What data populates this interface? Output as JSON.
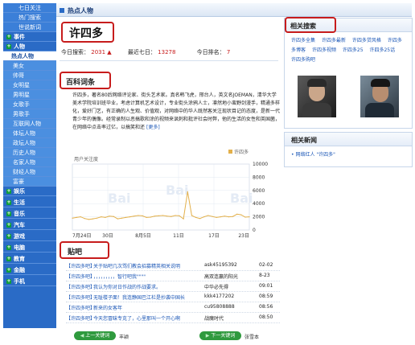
{
  "sidebar": {
    "items": [
      {
        "label": "七日关注",
        "kind": "top"
      },
      {
        "label": "热门搜索",
        "kind": "top"
      },
      {
        "label": "世说新词",
        "kind": "top"
      },
      {
        "label": "事件",
        "kind": "cat"
      },
      {
        "label": "人物",
        "kind": "cat"
      },
      {
        "label": "热点人物",
        "kind": "active"
      },
      {
        "label": "美女",
        "kind": "sub"
      },
      {
        "label": "帅哥",
        "kind": "sub"
      },
      {
        "label": "女明星",
        "kind": "sub"
      },
      {
        "label": "男明星",
        "kind": "sub"
      },
      {
        "label": "女歌手",
        "kind": "sub"
      },
      {
        "label": "男歌手",
        "kind": "sub"
      },
      {
        "label": "互联网人物",
        "kind": "sub"
      },
      {
        "label": "体坛人物",
        "kind": "sub"
      },
      {
        "label": "政坛人物",
        "kind": "sub"
      },
      {
        "label": "历史人物",
        "kind": "sub"
      },
      {
        "label": "名家人物",
        "kind": "sub"
      },
      {
        "label": "财经人物",
        "kind": "sub"
      },
      {
        "label": "富豪",
        "kind": "sub"
      },
      {
        "label": "娱乐",
        "kind": "cat"
      },
      {
        "label": "生活",
        "kind": "cat"
      },
      {
        "label": "音乐",
        "kind": "cat"
      },
      {
        "label": "汽车",
        "kind": "cat"
      },
      {
        "label": "游戏",
        "kind": "cat"
      },
      {
        "label": "电脑",
        "kind": "cat"
      },
      {
        "label": "教育",
        "kind": "cat"
      },
      {
        "label": "金融",
        "kind": "cat"
      },
      {
        "label": "手机",
        "kind": "cat"
      }
    ]
  },
  "header": {
    "title": "热点人物"
  },
  "person": {
    "name": "许四多",
    "today_search_label": "今日搜索：",
    "today_search_value": "2031",
    "recent7_label": "最近七日：",
    "recent7_value": "13278",
    "today_rank_label": "今日排名：",
    "today_rank_value": "7"
  },
  "baike": {
    "title": "百科词条",
    "text": "许四多，著名80后网络评论家、街头艺术家。真名韩飞虎，邢台人，英文名JOEMAN，清华大学美术学院培训班毕业，考虑计算机艺术设计，专业街头涂鸦人士，凛然地小蛮野剑漫手，精通多样化，爱好门艺，有正确的人生观、价值观，对网络中的华人既然客关注现状目记的态度，是新一代青少年的偶像。经常录制以恶搞歌和涂的视频来讽刺和批评社会时弊，他的生活的女性和英国菌，在网络中点击率过亿，以搞笑和还",
    "more": "[更多]"
  },
  "chart_data": {
    "type": "line",
    "title": "",
    "ylabel": "用户关注度",
    "legend": "许四多",
    "xtick_labels": [
      "7月24日",
      "30日",
      "8月5日",
      "11日",
      "17日",
      "23日"
    ],
    "ytick_labels": [
      "10000",
      "8000",
      "6000",
      "4000",
      "2000",
      "0"
    ],
    "ylim": [
      0,
      10000
    ],
    "values": [
      1800,
      1900,
      2000,
      1750,
      1600,
      1700,
      1800,
      2000,
      1900,
      2100,
      2050,
      1700,
      1800,
      1900,
      2000,
      2100,
      2200,
      2150,
      1900,
      1950,
      2100,
      2150,
      2200,
      2100,
      2050,
      2200,
      2150,
      1700,
      5800,
      2200,
      1900,
      1750,
      2000,
      2200,
      2050,
      1900,
      2000,
      2100,
      2000,
      2050,
      2400,
      2300,
      1950,
      2000
    ]
  },
  "tieba": {
    "title": "贴吧",
    "rows": [
      {
        "tag": "【许四多吧】",
        "subject": "关于贴吧几次骂们教会招募精英相关说明",
        "author": "ask45195392",
        "date": "02-02"
      },
      {
        "tag": "【许四多吧】",
        "subject": "，，，，，，，，，智行吧我\"\"\"\"",
        "author": "高双连赢的阳光",
        "date": "8-23"
      },
      {
        "tag": "【许四多吧】",
        "subject": "我认为你对日作战的作战要求。",
        "author": "中华必先得",
        "date": "09:01"
      },
      {
        "tag": "【许四多吧】",
        "subject": "无耻楼子面！我连静国巴江栏是抄袭中国长",
        "author": "kkk4177202",
        "date": "08:59"
      },
      {
        "tag": "【许四多吧】",
        "subject": "新来的女客年",
        "author": "cu95808888",
        "date": "08:56"
      },
      {
        "tag": "【许四多吧】",
        "subject": "今天您冒昧专克了，心里那叫一个开心啊",
        "author": "战魔时代",
        "date": "08:50"
      }
    ]
  },
  "footer": {
    "prev_label": "上一关键词",
    "prev_name": "丰颖",
    "next_label": "下一关键词",
    "next_name": "张雪本"
  },
  "related_search": {
    "title": "相关搜索",
    "links": [
      "许四多全集",
      "许四多最新",
      "许四多贷风格",
      "许四多",
      "多博客",
      "许四多视频",
      "许四多25",
      "许四多25话",
      "许四多购吧"
    ]
  },
  "related_news": {
    "title": "相关新闻",
    "items": [
      "网络红人 \"许四多\""
    ]
  },
  "colors": {
    "sidebar": "#2a6bc6",
    "accent": "#c71c1c",
    "link": "#1a56b6",
    "chart_line": "#e3b04b"
  }
}
